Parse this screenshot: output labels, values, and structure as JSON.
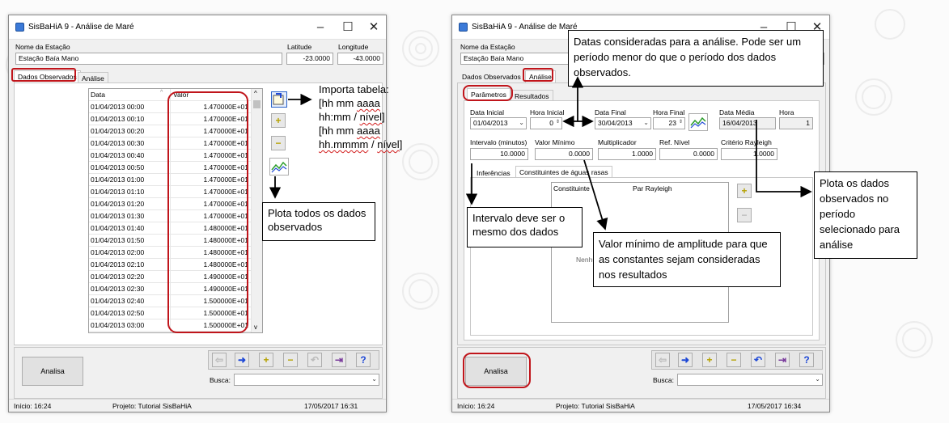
{
  "common": {
    "window_title": "SisBaHiA 9 - Análise de Maré",
    "station_label": "Nome da Estação",
    "station_value": "Estação Baía Mano",
    "lat_label": "Latitude",
    "lat_value": "-23.0000",
    "lon_label": "Longitude",
    "lon_value": "-43.0000",
    "tab_observed": "Dados Observados",
    "tab_analysis": "Análise",
    "analyze_button": "Analisa",
    "search_label": "Busca:",
    "search_value": "",
    "status_start": "Início: 16:24",
    "status_project": "Projeto: Tutorial SisBaHiA"
  },
  "left": {
    "status_datetime": "17/05/2017 16:31",
    "table": {
      "columns": [
        "Data",
        "Valor"
      ],
      "rows": [
        [
          "01/04/2013 00:00",
          "1.470000E+01"
        ],
        [
          "01/04/2013 00:10",
          "1.470000E+01"
        ],
        [
          "01/04/2013 00:20",
          "1.470000E+01"
        ],
        [
          "01/04/2013 00:30",
          "1.470000E+01"
        ],
        [
          "01/04/2013 00:40",
          "1.470000E+01"
        ],
        [
          "01/04/2013 00:50",
          "1.470000E+01"
        ],
        [
          "01/04/2013 01:00",
          "1.470000E+01"
        ],
        [
          "01/04/2013 01:10",
          "1.470000E+01"
        ],
        [
          "01/04/2013 01:20",
          "1.470000E+01"
        ],
        [
          "01/04/2013 01:30",
          "1.470000E+01"
        ],
        [
          "01/04/2013 01:40",
          "1.480000E+01"
        ],
        [
          "01/04/2013 01:50",
          "1.480000E+01"
        ],
        [
          "01/04/2013 02:00",
          "1.480000E+01"
        ],
        [
          "01/04/2013 02:10",
          "1.480000E+01"
        ],
        [
          "01/04/2013 02:20",
          "1.490000E+01"
        ],
        [
          "01/04/2013 02:30",
          "1.490000E+01"
        ],
        [
          "01/04/2013 02:40",
          "1.500000E+01"
        ],
        [
          "01/04/2013 02:50",
          "1.500000E+01"
        ],
        [
          "01/04/2013 03:00",
          "1.500000E+01"
        ]
      ]
    }
  },
  "right": {
    "status_datetime": "17/05/2017 16:34",
    "tab_params": "Parâmetros",
    "tab_results": "Resultados",
    "start_date_label": "Data Inicial",
    "start_date_value": "01/04/2013",
    "start_hour_label": "Hora Inicial",
    "start_hour_value": "0",
    "end_date_label": "Data Final",
    "end_date_value": "30/04/2013",
    "end_hour_label": "Hora Final",
    "end_hour_value": "23",
    "mid_date_label": "Data Média",
    "mid_date_value": "16/04/2013",
    "hour_label": "Hora",
    "hour_value": "1",
    "interval_label": "Intervalo (minutos)",
    "interval_value": "10.0000",
    "min_value_label": "Valor Mínimo",
    "min_value_value": "0.0000",
    "multiplier_label": "Multiplicador",
    "multiplier_value": "1.0000",
    "ref_level_label": "Ref. Nível",
    "ref_level_value": "0.0000",
    "rayleigh_label": "Critério Rayleigh",
    "rayleigh_value": "1.0000",
    "subtab_inferences": "Inferências",
    "subtab_shallow": "Constituintes de águas rasas",
    "list_col1": "Constituinte",
    "list_col2": "Par Rayleigh",
    "list_empty": "Nenhu"
  },
  "callouts": {
    "import_title": "Importa tabela:",
    "import_f1a": "[hh mm ",
    "import_f1b": "aaaa",
    "import_f2a": "hh:mm / ",
    "import_f2b": "nível",
    "import_f2c": "]",
    "import_f3a": "[hh mm ",
    "import_f3b": "aaaa",
    "import_f4a": "hh.mmmm",
    "import_f4b": " / ",
    "import_f4c": "nível",
    "import_f4d": "]",
    "plot_all": "Plota todos os dados observados",
    "dates": "Datas consideradas para a análise. Pode ser um período menor do que o período dos dados observados.",
    "interval": "Intervalo deve ser o mesmo dos dados",
    "min_amp": "Valor mínimo de amplitude para que as constantes sejam consideradas nos resultados",
    "plot_period": "Plota os dados observados no período selecionado para análise"
  },
  "icons": {
    "app": "app-icon",
    "import": "import-table-icon",
    "add": "plus-icon",
    "remove": "minus-icon",
    "plot": "chart-icon",
    "nav_back": "arrow-left-icon",
    "nav_forward": "arrow-right-icon",
    "undo": "undo-icon",
    "exit": "exit-icon",
    "help": "help-icon"
  },
  "colors": {
    "highlight": "#c0151b",
    "nav_blue": "#1f49d6",
    "accent_yellow": "#b5a100"
  }
}
